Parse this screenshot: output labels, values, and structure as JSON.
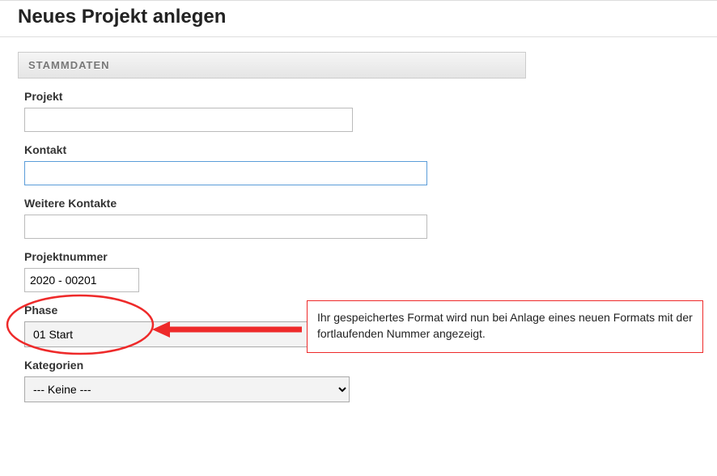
{
  "pageTitle": "Neues Projekt anlegen",
  "sectionTitle": "STAMMDATEN",
  "fields": {
    "projekt": {
      "label": "Projekt",
      "value": ""
    },
    "kontakt": {
      "label": "Kontakt",
      "value": ""
    },
    "weitere": {
      "label": "Weitere Kontakte",
      "value": ""
    },
    "projnr": {
      "label": "Projektnummer",
      "value": "2020 - 00201"
    },
    "phase": {
      "label": "Phase",
      "value": "01 Start"
    },
    "kategorien": {
      "label": "Kategorien",
      "value": "--- Keine ---"
    }
  },
  "annotation": {
    "text": "Ihr gespeichertes Format wird nun bei Anlage eines neuen Formats mit der fortlaufenden Nummer angezeigt."
  }
}
